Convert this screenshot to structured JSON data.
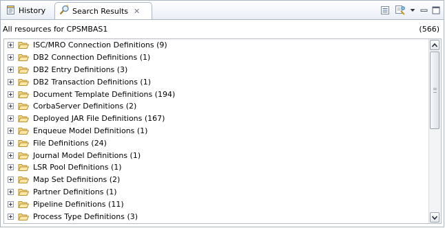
{
  "tabs": [
    {
      "label": "History",
      "icon": "history-page-icon"
    },
    {
      "label": "Search Results",
      "icon": "search-results-icon",
      "close_symbol": "✕"
    }
  ],
  "toolbar": {
    "icons": [
      "show-list-icon",
      "pin-view-icon",
      "view-menu-icon",
      "minimize-icon",
      "maximize-icon"
    ]
  },
  "status": {
    "label": "All resources for CPSMBAS1",
    "count": "(566)"
  },
  "tree": {
    "items": [
      "ISC/MRO Connection Definitions (9)",
      "DB2 Connection Definitions (1)",
      "DB2 Entry Definitions (3)",
      "DB2 Transaction Definitions (1)",
      "Document Template Definitions (194)",
      "CorbaServer Definitions (2)",
      "Deployed JAR File Definitions (167)",
      "Enqueue Model Definitions (1)",
      "File Definitions (24)",
      "Journal Model Definitions (1)",
      "LSR Pool Definitions (1)",
      "Map Set Definitions (2)",
      "Partner Definitions (1)",
      "Pipeline Definitions (11)",
      "Process Type Definitions (3)"
    ]
  },
  "colors": {
    "folder_fill": "#f6d88a",
    "folder_stroke": "#b8912f",
    "border": "#a9b4c5"
  }
}
